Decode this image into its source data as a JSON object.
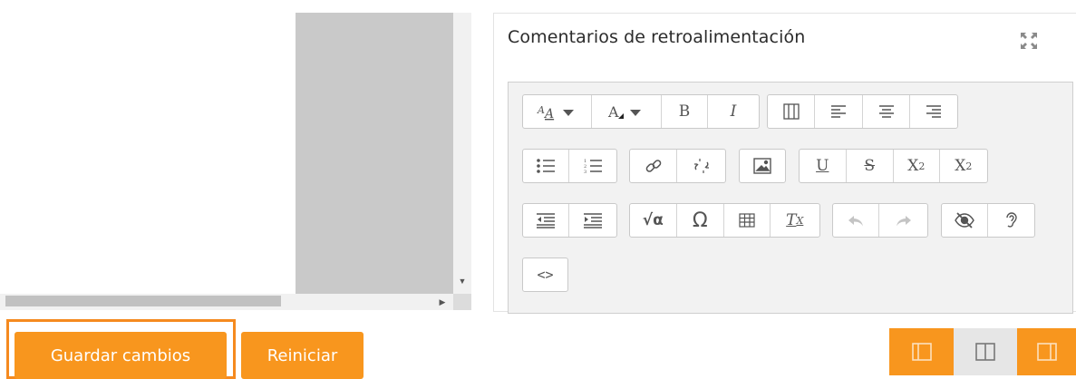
{
  "panel": {
    "title": "Comentarios de retroalimentación"
  },
  "buttons": {
    "save": "Guardar cambios",
    "reset": "Reiniciar"
  },
  "colors": {
    "accent": "#f8961e",
    "accent_border": "#f58a1f",
    "editor_bg": "#f2f2f2",
    "viewer_gray": "#c9c9c9"
  },
  "toolbar": {
    "row1": [
      {
        "name": "font-size-icon"
      },
      {
        "name": "font-color-icon"
      },
      {
        "name": "bold-icon",
        "label": "B"
      },
      {
        "name": "italic-icon",
        "label": "I"
      },
      {
        "name": "columns-icon"
      },
      {
        "name": "align-left-icon"
      },
      {
        "name": "align-center-icon"
      },
      {
        "name": "align-right-icon"
      }
    ],
    "row2": [
      {
        "name": "bullet-list-icon"
      },
      {
        "name": "numbered-list-icon"
      },
      {
        "name": "link-icon"
      },
      {
        "name": "unlink-icon"
      },
      {
        "name": "image-icon"
      },
      {
        "name": "underline-icon",
        "label": "U"
      },
      {
        "name": "strikethrough-icon",
        "label": "S"
      },
      {
        "name": "subscript-icon",
        "label": "X",
        "sub": "2"
      },
      {
        "name": "superscript-icon",
        "label": "X",
        "sup": "2"
      }
    ],
    "row3": [
      {
        "name": "outdent-icon"
      },
      {
        "name": "indent-icon"
      },
      {
        "name": "equation-icon",
        "label": "√α"
      },
      {
        "name": "special-char-icon",
        "label": "Ω"
      },
      {
        "name": "table-icon"
      },
      {
        "name": "clear-format-icon",
        "label": "T",
        "sub": "X"
      },
      {
        "name": "undo-icon"
      },
      {
        "name": "redo-icon"
      },
      {
        "name": "accessibility-checker-icon"
      },
      {
        "name": "screenreader-helper-icon"
      }
    ],
    "row4": [
      {
        "name": "html-source-icon",
        "label": "<>"
      }
    ]
  },
  "layout_icons": [
    "collapse-left-panel-icon",
    "standard-layout-icon",
    "collapse-right-panel-icon"
  ]
}
